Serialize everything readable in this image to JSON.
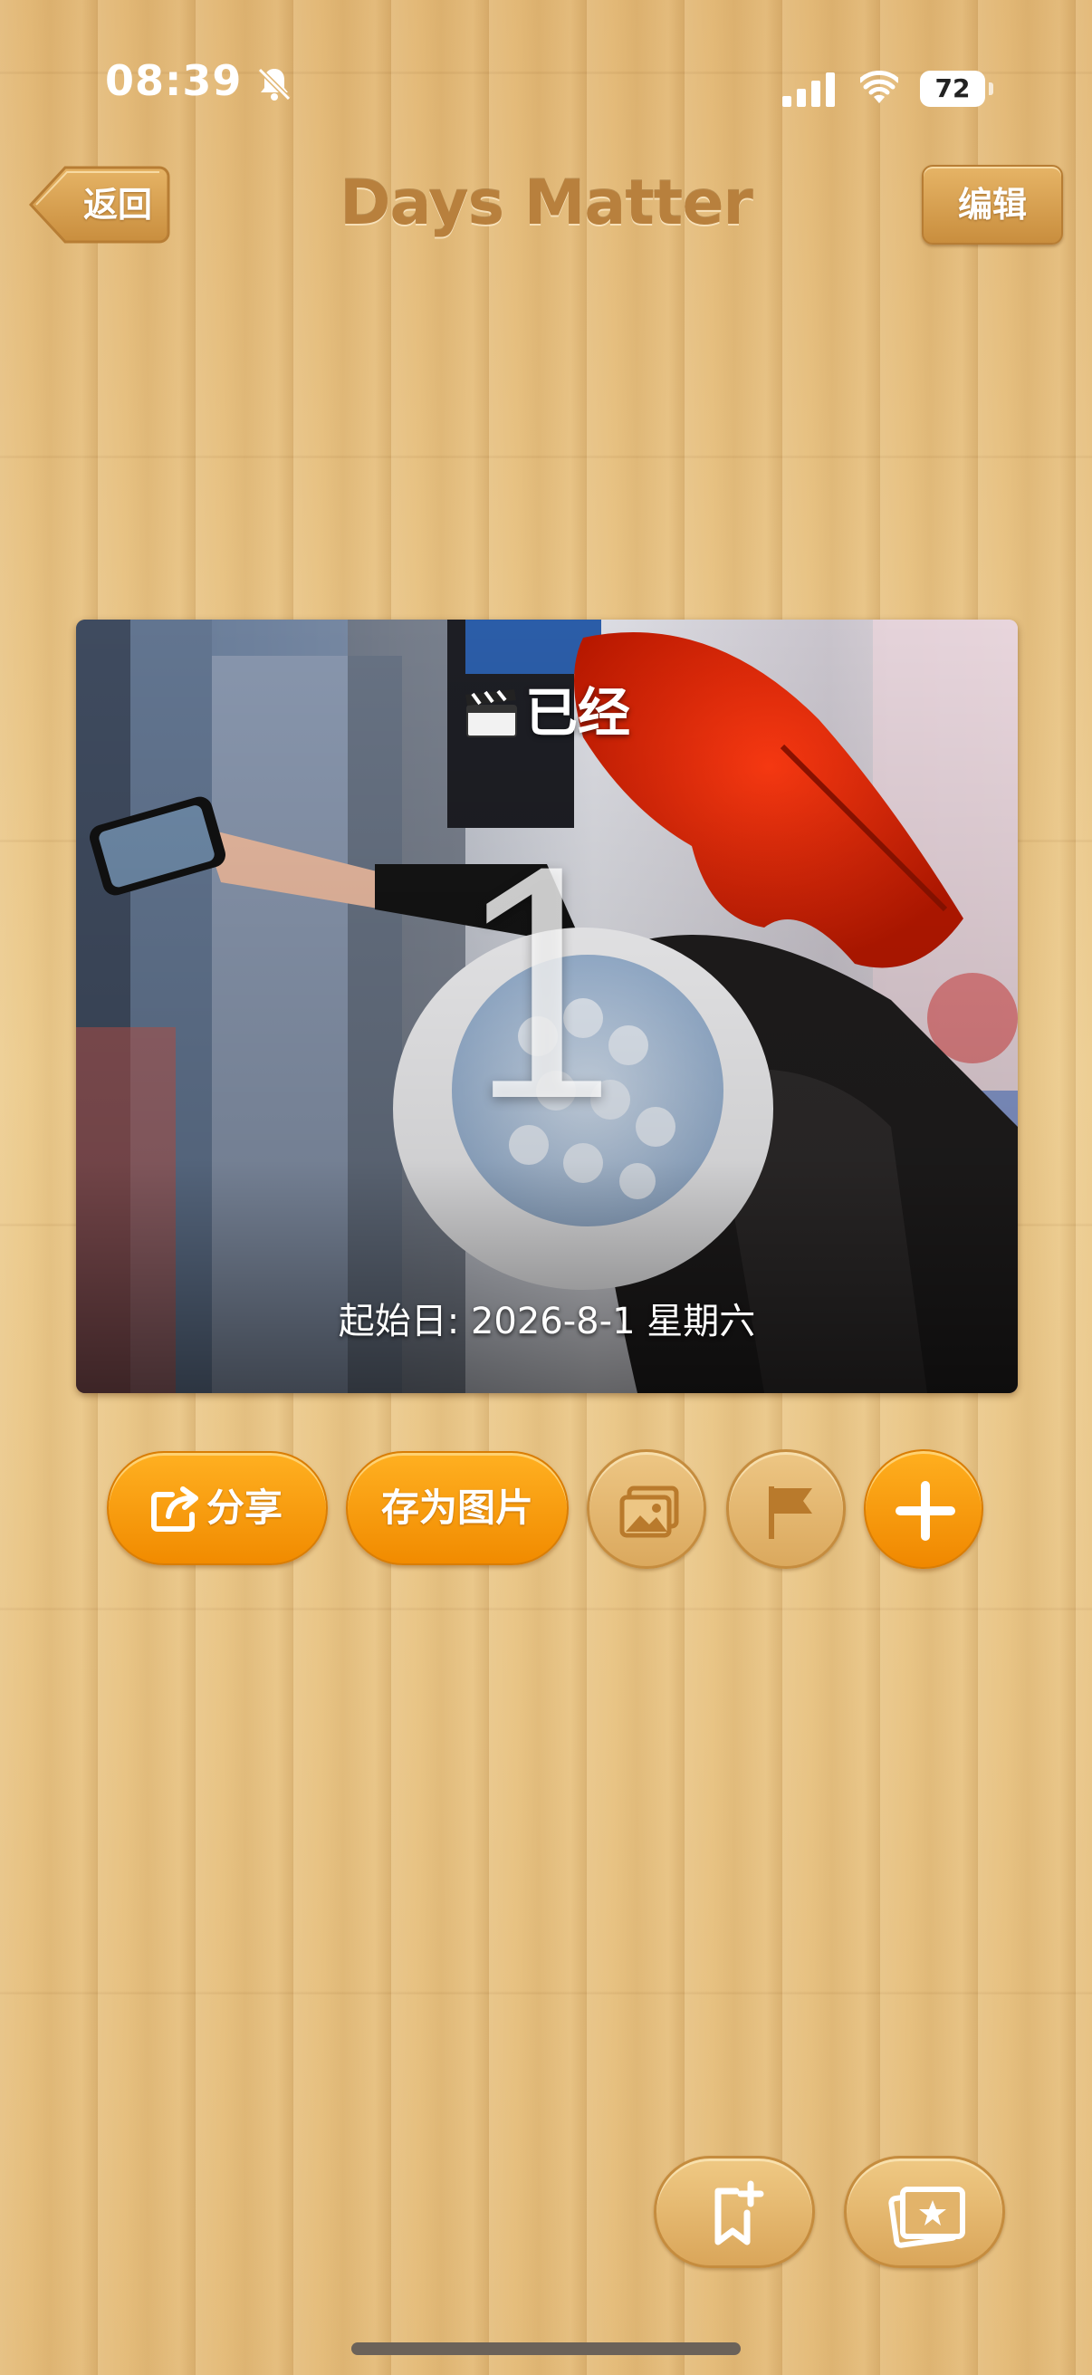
{
  "status_bar": {
    "time": "08:39",
    "battery": "72",
    "icons": [
      "bell-slash-icon",
      "cellular-signal-icon",
      "wifi-icon",
      "battery-icon"
    ]
  },
  "nav": {
    "back_label": "返回",
    "title": "Days Matter",
    "edit_label": "编辑"
  },
  "card": {
    "header": "已经",
    "header_icon": "clapperboard-icon",
    "count": "1",
    "start_date": "起始日: 2026-8-1 星期六"
  },
  "actions": {
    "share_label": "分享",
    "save_image_label": "存为图片",
    "icons": [
      "share-icon",
      "photo-icon",
      "flag-icon",
      "plus-icon"
    ]
  },
  "bottom": {
    "icons": [
      "bookmark-add-icon",
      "star-cards-icon"
    ]
  },
  "colors": {
    "accent_orange": "#f59a0a",
    "title_brown": "#b8803d",
    "wood": "#e6bf7c"
  }
}
